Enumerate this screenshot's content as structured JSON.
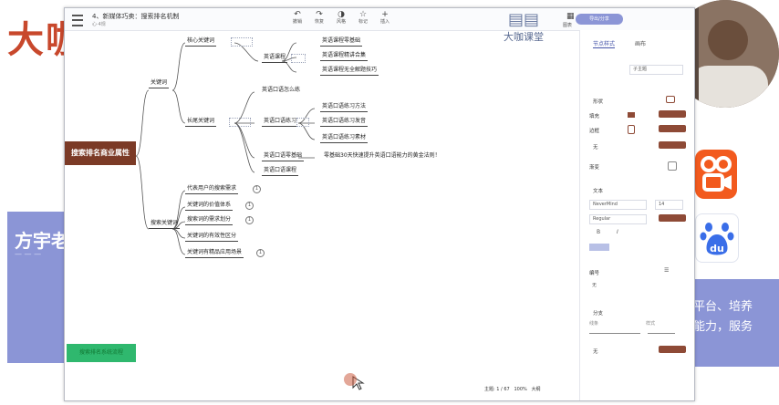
{
  "background": {
    "slide_title": "大咖",
    "blue_card_text": "方宇老",
    "blue_card_sub": "— — —",
    "right_text_line1": "平台、培养",
    "right_text_line2": "能力，服务",
    "colors": {
      "brand_red": "#c8482c",
      "blue": "#8b95d6",
      "brown": "#8e4a36",
      "green": "#2fb86e"
    }
  },
  "window": {
    "title": "4、新媒体巧卖：搜索排名机制",
    "subtitle": "心·4规",
    "toolbar": [
      {
        "icon": "undo-icon",
        "label": "撤销"
      },
      {
        "icon": "redo-icon",
        "label": "恢复"
      },
      {
        "icon": "style-icon",
        "label": "风格"
      },
      {
        "icon": "star-icon",
        "label": "标记"
      },
      {
        "icon": "plus-icon",
        "label": "插入"
      }
    ],
    "logo_text": "大咖课堂",
    "export_label": "导出/分享",
    "side_icon_label": "图表"
  },
  "mindmap": {
    "root": "搜索排名商业属性",
    "branch_keywords": "关键词",
    "core_keywords": "核心关键词",
    "english_course": "英语课程",
    "english_children": [
      "英语课程零基础",
      "英语课程精讲合集",
      "英语课程无全解题技巧"
    ],
    "longtail_keywords": "长尾关键词",
    "longtail_children": [
      "英语口语怎么练",
      "英语口语练习",
      "英语口语零基础",
      "英语口语课程"
    ],
    "practice_children": [
      "英语口语练习方法",
      "英语口语练习发音",
      "英语口语练习素材"
    ],
    "zero_child": "零基础30天快速提升英语口语能力的黄金法则！",
    "search_keywords": "搜索关键词",
    "search_children": [
      "代表用户的搜索需求",
      "关键词的价值体系",
      "搜索词的需求划分",
      "关键词的有效性区分",
      "关键词有精品应用场景"
    ],
    "left_buttons": [
      "",
      "",
      "搜索排名系统流程"
    ]
  },
  "panel": {
    "tabs": [
      "节点样式",
      "画布"
    ],
    "sub_tab": "子主题",
    "shape_label": "形状",
    "fill_label": "填充",
    "border_label": "边框",
    "none_label": "无",
    "gradient_label": "渐变",
    "text_label": "文本",
    "font_name": "NeverMind",
    "font_size": "14",
    "font_weight": "Regular",
    "line_label": "编号",
    "line_value": "无",
    "branch_label": "分支",
    "branch_width_label": "线条",
    "branch_style_label": "样式",
    "color_label": "颜色",
    "accent_color": "#8e4a36"
  },
  "status": {
    "topic_count": "主题: 1 / 67",
    "zoom": "100%",
    "size_label": "大纲"
  }
}
